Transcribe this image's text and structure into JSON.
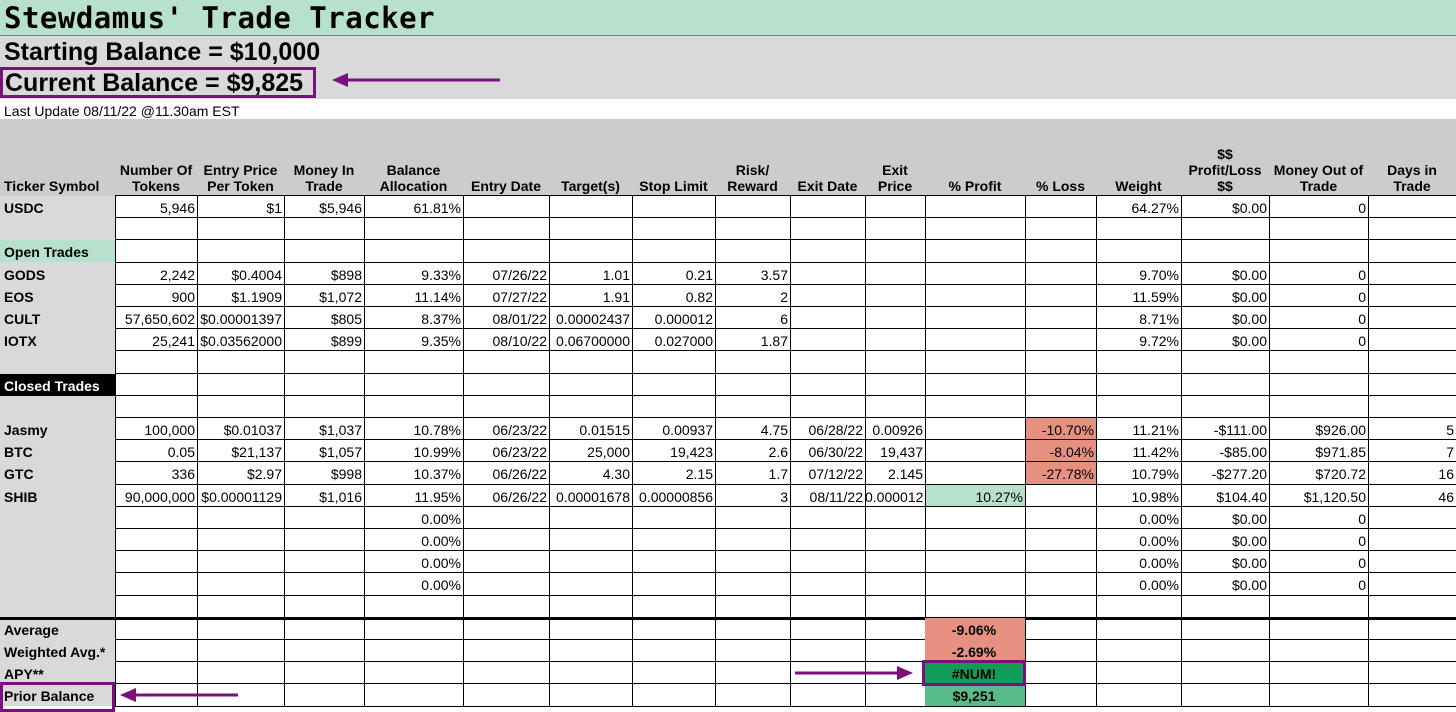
{
  "title": "Stewdamus' Trade Tracker",
  "starting_balance": "Starting Balance = $10,000",
  "current_balance": "Current Balance = $9,825",
  "last_update": "Last Update 08/11/22 @11.30am EST",
  "headers": [
    "Ticker Symbol",
    "Number Of\nTokens",
    "Entry Price\nPer Token",
    "Money In\nTrade",
    "Balance\nAllocation",
    "Entry Date",
    "Target(s)",
    "Stop Limit",
    "Risk/\nReward",
    "Exit Date",
    "Exit\nPrice",
    "% Profit",
    "% Loss",
    "Weight",
    "$$\nProfit/Loss\n$$",
    "Money Out of\nTrade",
    "Days in\nTrade"
  ],
  "sections": {
    "open_trades": "Open Trades",
    "closed_trades": "Closed Trades"
  },
  "rows": [
    {
      "row": 0,
      "cells": [
        "USDC",
        "5,946",
        "$1",
        "$5,946",
        "61.81%",
        "",
        "",
        "",
        "",
        "",
        "",
        "",
        "",
        "64.27%",
        "$0.00",
        "0",
        ""
      ]
    },
    {
      "row": 3,
      "cells": [
        "GODS",
        "2,242",
        "$0.4004",
        "$898",
        "9.33%",
        "07/26/22",
        "1.01",
        "0.21",
        "3.57",
        "",
        "",
        "",
        "",
        "9.70%",
        "$0.00",
        "0",
        ""
      ]
    },
    {
      "row": 4,
      "cells": [
        "EOS",
        "900",
        "$1.1909",
        "$1,072",
        "11.14%",
        "07/27/22",
        "1.91",
        "0.82",
        "2",
        "",
        "",
        "",
        "",
        "11.59%",
        "$0.00",
        "0",
        ""
      ]
    },
    {
      "row": 5,
      "cells": [
        "CULT",
        "57,650,602",
        "$0.00001397",
        "$805",
        "8.37%",
        "08/01/22",
        "0.00002437",
        "0.000012",
        "6",
        "",
        "",
        "",
        "",
        "8.71%",
        "$0.00",
        "0",
        ""
      ]
    },
    {
      "row": 6,
      "cells": [
        "IOTX",
        "25,241",
        "$0.03562000",
        "$899",
        "9.35%",
        "08/10/22",
        "0.06700000",
        "0.027000",
        "1.87",
        "",
        "",
        "",
        "",
        "9.72%",
        "$0.00",
        "0",
        ""
      ]
    },
    {
      "row": 10,
      "cells": [
        "Jasmy",
        "100,000",
        "$0.01037",
        "$1,037",
        "10.78%",
        "06/23/22",
        "0.01515",
        "0.00937",
        "4.75",
        "06/28/22",
        "0.00926",
        "",
        "-10.70%",
        "11.21%",
        "-$111.00",
        "$926.00",
        "5"
      ]
    },
    {
      "row": 11,
      "cells": [
        "BTC",
        "0.05",
        "$21,137",
        "$1,057",
        "10.99%",
        "06/23/22",
        "25,000",
        "19,423",
        "2.6",
        "06/30/22",
        "19,437",
        "",
        "-8.04%",
        "11.42%",
        "-$85.00",
        "$971.85",
        "7"
      ]
    },
    {
      "row": 12,
      "cells": [
        "GTC",
        "336",
        "$2.97",
        "$998",
        "10.37%",
        "06/26/22",
        "4.30",
        "2.15",
        "1.7",
        "07/12/22",
        "2.145",
        "",
        "-27.78%",
        "10.79%",
        "-$277.20",
        "$720.72",
        "16"
      ]
    },
    {
      "row": 13,
      "cells": [
        "SHIB",
        "90,000,000",
        "$0.00001129",
        "$1,016",
        "11.95%",
        "06/26/22",
        "0.00001678",
        "0.00000856",
        "3",
        "08/11/22",
        "0.000012",
        "10.27%",
        "",
        "10.98%",
        "$104.40",
        "$1,120.50",
        "46"
      ]
    },
    {
      "row": 14,
      "cells": [
        "",
        "",
        "",
        "",
        "0.00%",
        "",
        "",
        "",
        "",
        "",
        "",
        "",
        "",
        "0.00%",
        "$0.00",
        "0",
        ""
      ]
    },
    {
      "row": 15,
      "cells": [
        "",
        "",
        "",
        "",
        "0.00%",
        "",
        "",
        "",
        "",
        "",
        "",
        "",
        "",
        "0.00%",
        "$0.00",
        "0",
        ""
      ]
    },
    {
      "row": 16,
      "cells": [
        "",
        "",
        "",
        "",
        "0.00%",
        "",
        "",
        "",
        "",
        "",
        "",
        "",
        "",
        "0.00%",
        "$0.00",
        "0",
        ""
      ]
    },
    {
      "row": 17,
      "cells": [
        "",
        "",
        "",
        "",
        "0.00%",
        "",
        "",
        "",
        "",
        "",
        "",
        "",
        "",
        "0.00%",
        "$0.00",
        "0",
        ""
      ]
    }
  ],
  "summary": {
    "average_label": "Average",
    "average_value": "-9.06%",
    "weighted_label": "Weighted Avg.*",
    "weighted_value": "-2.69%",
    "apy_label": "APY**",
    "apy_value": "#NUM!",
    "prior_label": "Prior Balance",
    "prior_value": "$9,251"
  },
  "colors": {
    "title_bg": "#b7e1cd",
    "loss": "#e6917f",
    "profit": "#b7e1cd",
    "apy": "#0f9d58",
    "prior": "#57bb8a",
    "highlight": "#7b0f7c"
  }
}
